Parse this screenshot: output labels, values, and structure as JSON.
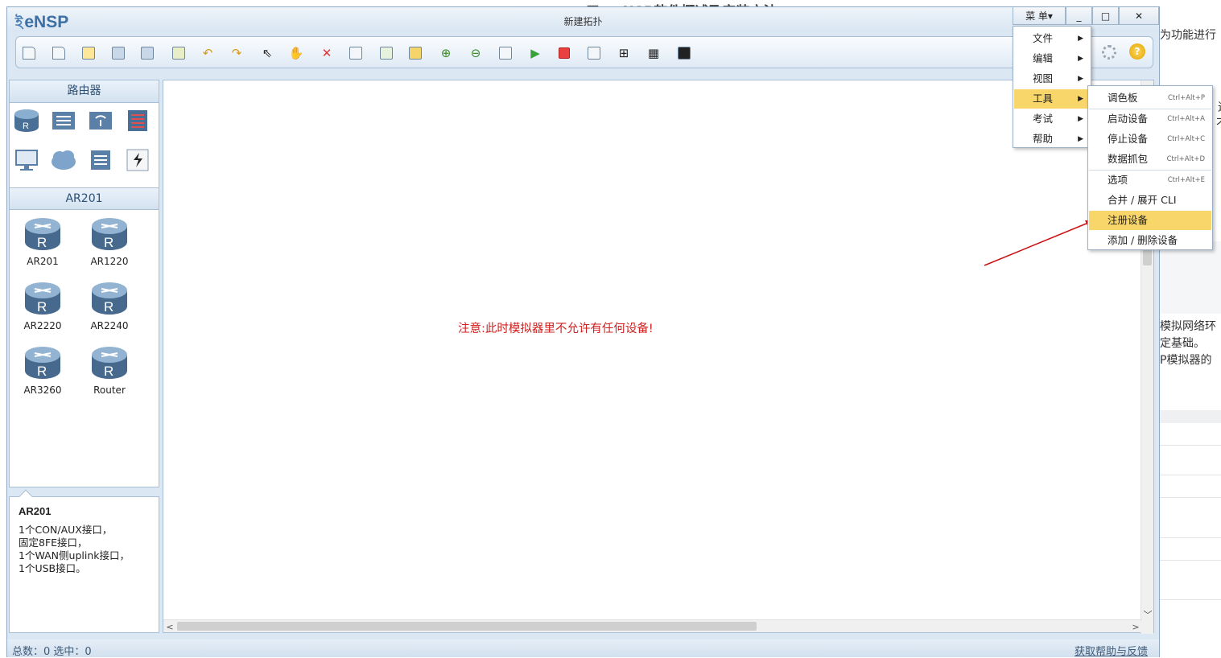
{
  "background": {
    "title_partial": "三、eNSP软件概述及安装方法",
    "right_lines": [
      "为功能进行",
      "进",
      "不能",
      "模拟网络环",
      "定基础。",
      "P模拟器的"
    ]
  },
  "window": {
    "logo": "eNSP",
    "title": "新建拓扑",
    "menu_button": "菜 单▾",
    "minimize": "_",
    "maximize": "□",
    "close": "✕"
  },
  "left_panel": {
    "category_header": "路由器",
    "device_header": "AR201",
    "devices": [
      {
        "name": "AR201"
      },
      {
        "name": "AR1220"
      },
      {
        "name": "AR2220"
      },
      {
        "name": "AR2240"
      },
      {
        "name": "AR3260"
      },
      {
        "name": "Router"
      }
    ]
  },
  "description": {
    "title": "AR201",
    "lines": [
      "1个CON/AUX接口，",
      "固定8FE接口，",
      "1个WAN侧uplink接口，",
      "1个USB接口。"
    ]
  },
  "canvas": {
    "notice": "注意:此时模拟器里不允许有任何设备!"
  },
  "status": {
    "left": "总数：0  选中：0",
    "help_link": "获取帮助与反馈"
  },
  "menu": {
    "items": [
      {
        "label": "文件"
      },
      {
        "label": "编辑"
      },
      {
        "label": "视图"
      },
      {
        "label": "工具"
      },
      {
        "label": "考试"
      },
      {
        "label": "帮助"
      }
    ],
    "highlighted": "工具"
  },
  "submenu": {
    "items": [
      {
        "label": "调色板",
        "shortcut": "Ctrl+Alt+P"
      },
      {
        "label": "启动设备",
        "shortcut": "Ctrl+Alt+A"
      },
      {
        "label": "停止设备",
        "shortcut": "Ctrl+Alt+C"
      },
      {
        "label": "数据抓包",
        "shortcut": "Ctrl+Alt+D"
      },
      {
        "label": "选项",
        "shortcut": "Ctrl+Alt+E"
      },
      {
        "label": "合并 / 展开 CLI",
        "shortcut": ""
      },
      {
        "label": "注册设备",
        "shortcut": ""
      },
      {
        "label": "添加 / 删除设备",
        "shortcut": ""
      }
    ],
    "highlighted": "注册设备"
  },
  "toolbar_icons": [
    "new-topology",
    "new-lab",
    "open",
    "save",
    "save-as",
    "print",
    "undo",
    "redo",
    "select",
    "pan",
    "delete",
    "delete-link",
    "text",
    "palette",
    "zoom-in",
    "zoom-out",
    "fit",
    "start",
    "stop",
    "capture",
    "topology",
    "grid",
    "screenshot"
  ],
  "accent_colors": {
    "highlight": "#f9d66a",
    "notice": "#d01f1f",
    "arrow": "#cc1111"
  }
}
